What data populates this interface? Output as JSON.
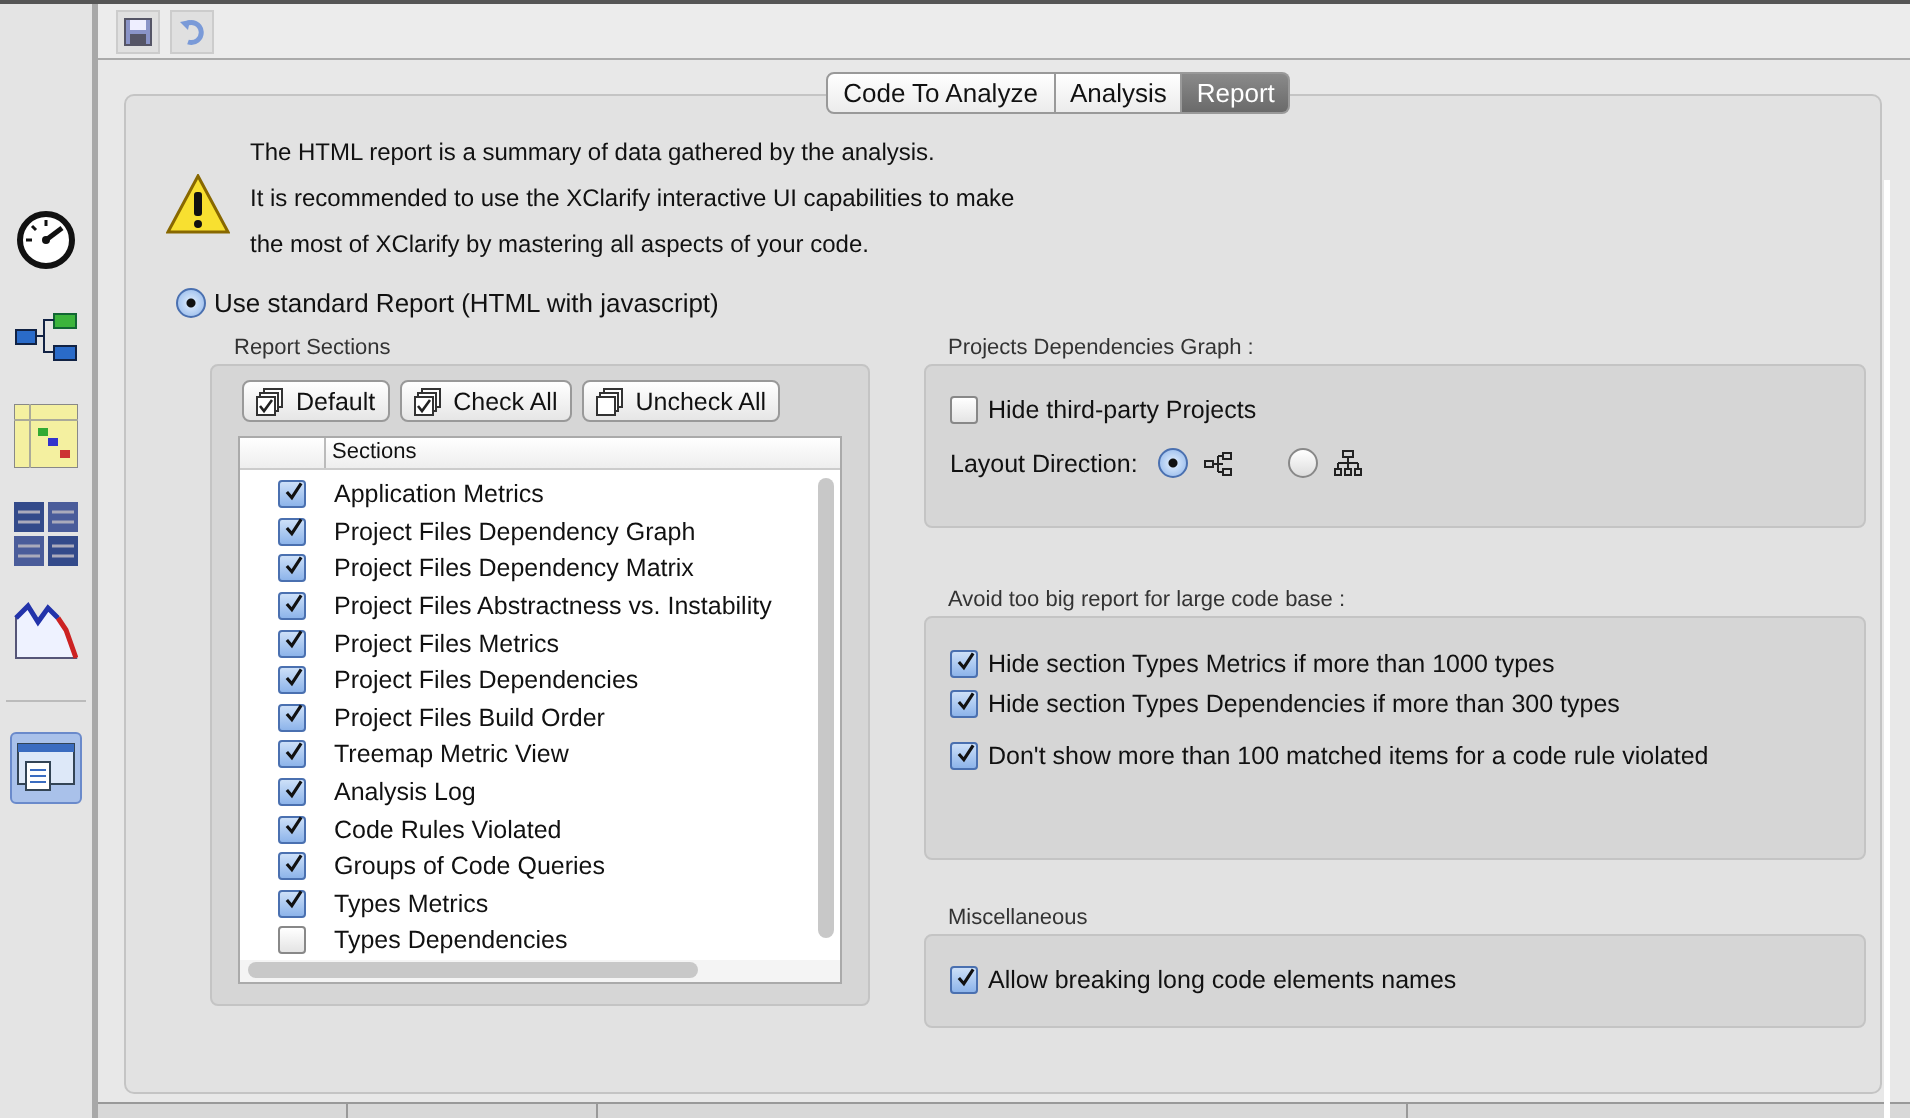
{
  "sidebar": {
    "items": [
      {
        "kind": "gauge",
        "selected": false
      },
      {
        "kind": "tree",
        "selected": false
      },
      {
        "kind": "matrix",
        "selected": false
      },
      {
        "kind": "treemap",
        "selected": false
      },
      {
        "kind": "chart",
        "selected": false
      },
      {
        "kind": "report",
        "selected": true
      }
    ]
  },
  "tabs": [
    {
      "label": "Code To Analyze",
      "selected": false
    },
    {
      "label": "Analysis",
      "selected": false
    },
    {
      "label": "Report",
      "selected": true
    }
  ],
  "notice": {
    "lines": [
      "The HTML report is a summary of data gathered by the analysis.",
      "It is recommended to use the XClarify interactive UI capabilities to make",
      "the most of XClarify by mastering all aspects of your code."
    ]
  },
  "report_mode": {
    "label": "Use standard Report (HTML with javascript)",
    "selected": true
  },
  "report_sections": {
    "title": "Report Sections",
    "buttons": [
      {
        "label": "Default",
        "kind": "default"
      },
      {
        "label": "Check All",
        "kind": "check"
      },
      {
        "label": "Uncheck All",
        "kind": "uncheck"
      }
    ],
    "column": "Sections",
    "rows": [
      {
        "label": "Application Metrics",
        "checked": true
      },
      {
        "label": "Project Files Dependency Graph",
        "checked": true
      },
      {
        "label": "Project Files Dependency Matrix",
        "checked": true
      },
      {
        "label": "Project Files Abstractness vs. Instability",
        "checked": true
      },
      {
        "label": "Project Files Metrics",
        "checked": true
      },
      {
        "label": "Project Files Dependencies",
        "checked": true
      },
      {
        "label": "Project Files Build Order",
        "checked": true
      },
      {
        "label": "Treemap Metric View",
        "checked": true
      },
      {
        "label": "Analysis Log",
        "checked": true
      },
      {
        "label": "Code Rules Violated",
        "checked": true
      },
      {
        "label": "Groups of Code Queries",
        "checked": true
      },
      {
        "label": "Types Metrics",
        "checked": true
      },
      {
        "label": "Types Dependencies",
        "checked": false
      }
    ]
  },
  "graph": {
    "title": "Projects Dependencies Graph :",
    "hide_third_party": {
      "label": "Hide third-party Projects",
      "checked": false
    },
    "layout_direction": {
      "label": "Layout Direction:",
      "options": [
        {
          "kind": "horizontal",
          "selected": true
        },
        {
          "kind": "vertical",
          "selected": false
        }
      ]
    }
  },
  "size_limits": {
    "title": "Avoid too big report for large code base :",
    "options": [
      {
        "label": "Hide section Types Metrics if more than 1000 types",
        "checked": true
      },
      {
        "label": "Hide section Types Dependencies if more than 300 types",
        "checked": true
      },
      {
        "label": "Don't show more than 100 matched items for a code rule violated",
        "checked": true
      }
    ]
  },
  "misc": {
    "title": "Miscellaneous",
    "options": [
      {
        "label": "Allow breaking long code elements names",
        "checked": true
      }
    ]
  }
}
